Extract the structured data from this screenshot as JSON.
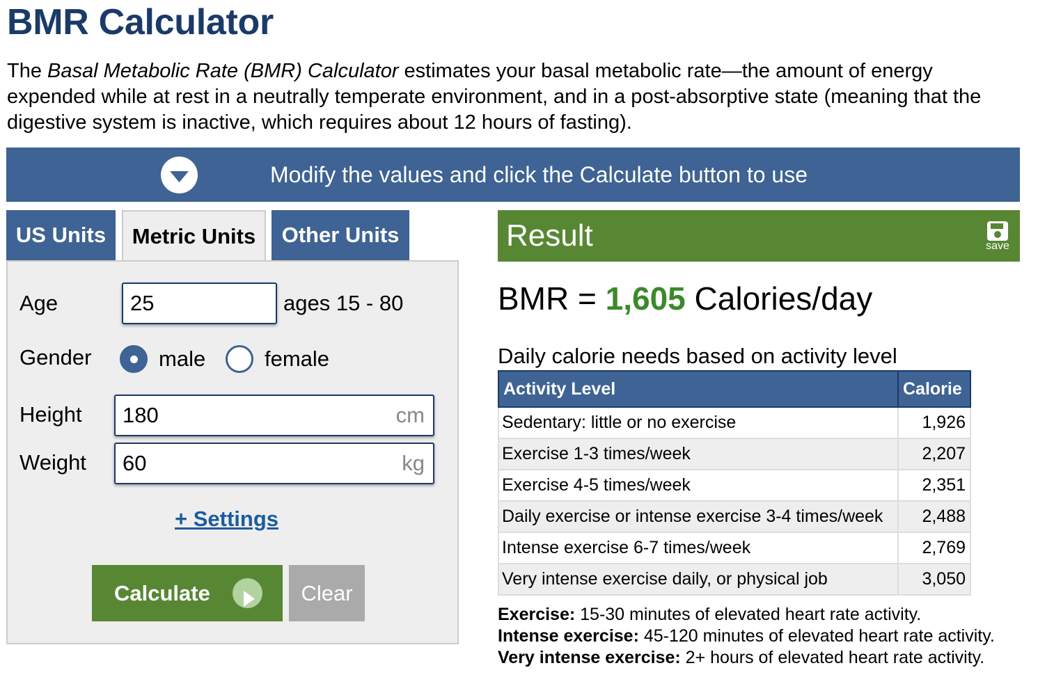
{
  "title": "BMR Calculator",
  "intro": {
    "prefix": "The ",
    "italic": "Basal Metabolic Rate (BMR) Calculator",
    "rest": " estimates your basal metabolic rate—the amount of energy expended while at rest in a neutrally temperate environment, and in a post-absorptive state (meaning that the digestive system is inactive, which requires about 12 hours of fasting)."
  },
  "banner": {
    "text": "Modify the values and click the Calculate button to use",
    "icon": "chevron-down-circle-icon"
  },
  "tabs": [
    {
      "label": "US Units",
      "active": false
    },
    {
      "label": "Metric Units",
      "active": true
    },
    {
      "label": "Other Units",
      "active": false
    }
  ],
  "form": {
    "age_label": "Age",
    "age_value": "25",
    "age_hint": "ages 15 - 80",
    "gender_label": "Gender",
    "gender_male": "male",
    "gender_female": "female",
    "gender_selected": "male",
    "height_label": "Height",
    "height_value": "180",
    "height_unit": "cm",
    "weight_label": "Weight",
    "weight_value": "60",
    "weight_unit": "kg",
    "settings_link": "+ Settings",
    "calculate_label": "Calculate",
    "clear_label": "Clear"
  },
  "result": {
    "header": "Result",
    "save_label": "save",
    "bmr_prefix": "BMR = ",
    "bmr_value": "1,605",
    "bmr_suffix": " Calories/day",
    "daily_heading": "Daily calorie needs based on activity level",
    "table_headers": [
      "Activity Level",
      "Calorie"
    ],
    "rows": [
      {
        "activity": "Sedentary: little or no exercise",
        "calorie": "1,926"
      },
      {
        "activity": "Exercise 1-3 times/week",
        "calorie": "2,207"
      },
      {
        "activity": "Exercise 4-5 times/week",
        "calorie": "2,351"
      },
      {
        "activity": "Daily exercise or intense exercise 3-4 times/week",
        "calorie": "2,488"
      },
      {
        "activity": "Intense exercise 6-7 times/week",
        "calorie": "2,769"
      },
      {
        "activity": "Very intense exercise daily, or physical job",
        "calorie": "3,050"
      }
    ],
    "notes": [
      {
        "term": "Exercise:",
        "text": " 15-30 minutes of elevated heart rate activity."
      },
      {
        "term": "Intense exercise:",
        "text": " 45-120 minutes of elevated heart rate activity."
      },
      {
        "term": "Very intense exercise:",
        "text": " 2+ hours of elevated heart rate activity."
      }
    ]
  },
  "colors": {
    "title": "#1b3a68",
    "banner": "#3e6394",
    "result_green": "#578733",
    "bmr_value": "#3a8a2a",
    "clear_gray": "#aaaaaa"
  }
}
